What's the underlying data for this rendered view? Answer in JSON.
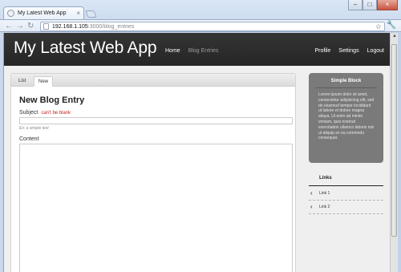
{
  "browser": {
    "tab_title": "My Latest Web App",
    "tab_close": "×",
    "url_host": "192.168.1.105",
    "url_path": ":3000/blog_entries",
    "back": "←",
    "forward": "→",
    "reload": "↻",
    "star": "☆",
    "wrench": "🔧",
    "minimize": "–",
    "maximize": "□",
    "close": "×"
  },
  "header": {
    "brand": "My Latest Web App",
    "nav": [
      {
        "label": "Home",
        "active": false
      },
      {
        "label": "Blog Entries",
        "active": true
      }
    ],
    "user_nav": [
      "Profile",
      "Settings",
      "Logout"
    ]
  },
  "main": {
    "tabs": [
      "List",
      "New"
    ],
    "active_tab": "New",
    "title": "New Blog Entry",
    "subject_label": "Subject",
    "subject_error": "can't be blank",
    "subject_value": "",
    "subject_hint": "Ex: a simple text",
    "content_label": "Content",
    "content_value": ""
  },
  "sidebar": {
    "block_title": "Simple Block",
    "block_text": "Lorem ipsum dolor sit amet, consectetur adipisicing elit, sed do eiusmod tempor incididunt ut labore et dolore magna aliqua. Ut enim ad minim veniam, quis nostrud exercitation ullamco laboris nisi ut aliquip ex ea commodo consequat.",
    "links_title": "Links",
    "links": [
      "Link 1",
      "Link 2"
    ],
    "link_icon": "‹"
  },
  "colors": {
    "header_bg": "#2d2d2d",
    "error": "#cc1f1f",
    "sidebar_block_bg": "#7a7a7a"
  }
}
